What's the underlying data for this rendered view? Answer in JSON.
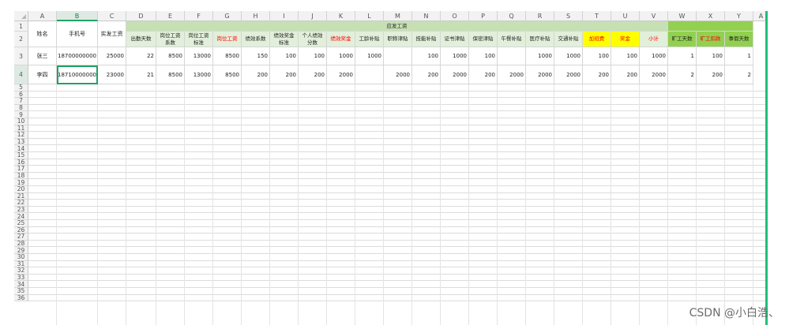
{
  "columns": [
    "A",
    "B",
    "C",
    "D",
    "E",
    "F",
    "G",
    "H",
    "I",
    "J",
    "K",
    "L",
    "M",
    "N",
    "O",
    "P",
    "Q",
    "R",
    "S",
    "T",
    "U",
    "V",
    "W",
    "X",
    "Y"
  ],
  "extra_column": "A",
  "selected_column": "B",
  "selected_row": "4",
  "row_numbers": [
    "1",
    "2",
    "3",
    "4",
    "5",
    "6",
    "7",
    "8",
    "9",
    "10",
    "11",
    "12",
    "13",
    "14",
    "15",
    "16",
    "17",
    "18",
    "19",
    "20",
    "21",
    "22",
    "23",
    "24",
    "25",
    "26",
    "27",
    "28",
    "29",
    "30",
    "31",
    "32",
    "33",
    "34",
    "35",
    "36"
  ],
  "group_header": "应发工资",
  "headers": {
    "name": "姓名",
    "phone": "手机号",
    "actual_salary": "实发工资",
    "attendance_days": "出勤天数",
    "position_coeff": "岗位工资系数",
    "position_std": "岗位工资标准",
    "position_salary": "岗位工资",
    "perf_coeff": "绩效系数",
    "perf_bonus_std": "绩效奖金标准",
    "personal_perf_score": "个人绩效分数",
    "perf_bonus": "绩效奖金",
    "seniority_allowance": "工龄补贴",
    "title_allowance": "职称津贴",
    "skill_allowance": "技能补贴",
    "cert_allowance": "证书津贴",
    "secrecy_allowance": "保密津贴",
    "lunch_allowance": "午餐补贴",
    "medical_allowance": "医疗补贴",
    "transport_allowance": "交通补贴",
    "yellow_t": "加班费",
    "yellow_u": "奖金",
    "subtotal": "小计",
    "absence_days": "旷工天数",
    "absence_deduction": "旷工扣款",
    "leave_days": "事假天数"
  },
  "rows": [
    {
      "name": "张三",
      "phone": "18700000000",
      "actual_salary": "25000",
      "attendance_days": "22",
      "position_coeff": "8500",
      "position_std": "13000",
      "position_salary": "8500",
      "perf_coeff": "150",
      "perf_bonus_std": "100",
      "personal_perf_score": "100",
      "perf_bonus": "1000",
      "seniority_allowance": "1000",
      "title_allowance": "",
      "skill_allowance": "100",
      "cert_allowance": "1000",
      "secrecy_allowance": "100",
      "lunch_allowance": "",
      "medical_allowance": "1000",
      "transport_allowance": "1000",
      "yellow_t": "100",
      "yellow_u": "100",
      "subtotal": "1000",
      "absence_days": "1",
      "absence_deduction": "100",
      "leave_days": "1"
    },
    {
      "name": "李四",
      "phone": "18710000000",
      "actual_salary": "23000",
      "attendance_days": "21",
      "position_coeff": "8500",
      "position_std": "13000",
      "position_salary": "8500",
      "perf_coeff": "200",
      "perf_bonus_std": "200",
      "personal_perf_score": "200",
      "perf_bonus": "2000",
      "seniority_allowance": "",
      "title_allowance": "2000",
      "skill_allowance": "200",
      "cert_allowance": "2000",
      "secrecy_allowance": "200",
      "lunch_allowance": "2000",
      "medical_allowance": "2000",
      "transport_allowance": "2000",
      "yellow_t": "200",
      "yellow_u": "200",
      "subtotal": "2000",
      "absence_days": "2",
      "absence_deduction": "200",
      "leave_days": "2"
    }
  ],
  "watermark": "CSDN @小白浩、",
  "colors": {
    "group_green": "#c6e0b4",
    "header_light": "#e2efda",
    "right_green": "#92d050",
    "yellow": "#ffff00",
    "red_text": "#ff0000",
    "selection": "#1fa363"
  }
}
